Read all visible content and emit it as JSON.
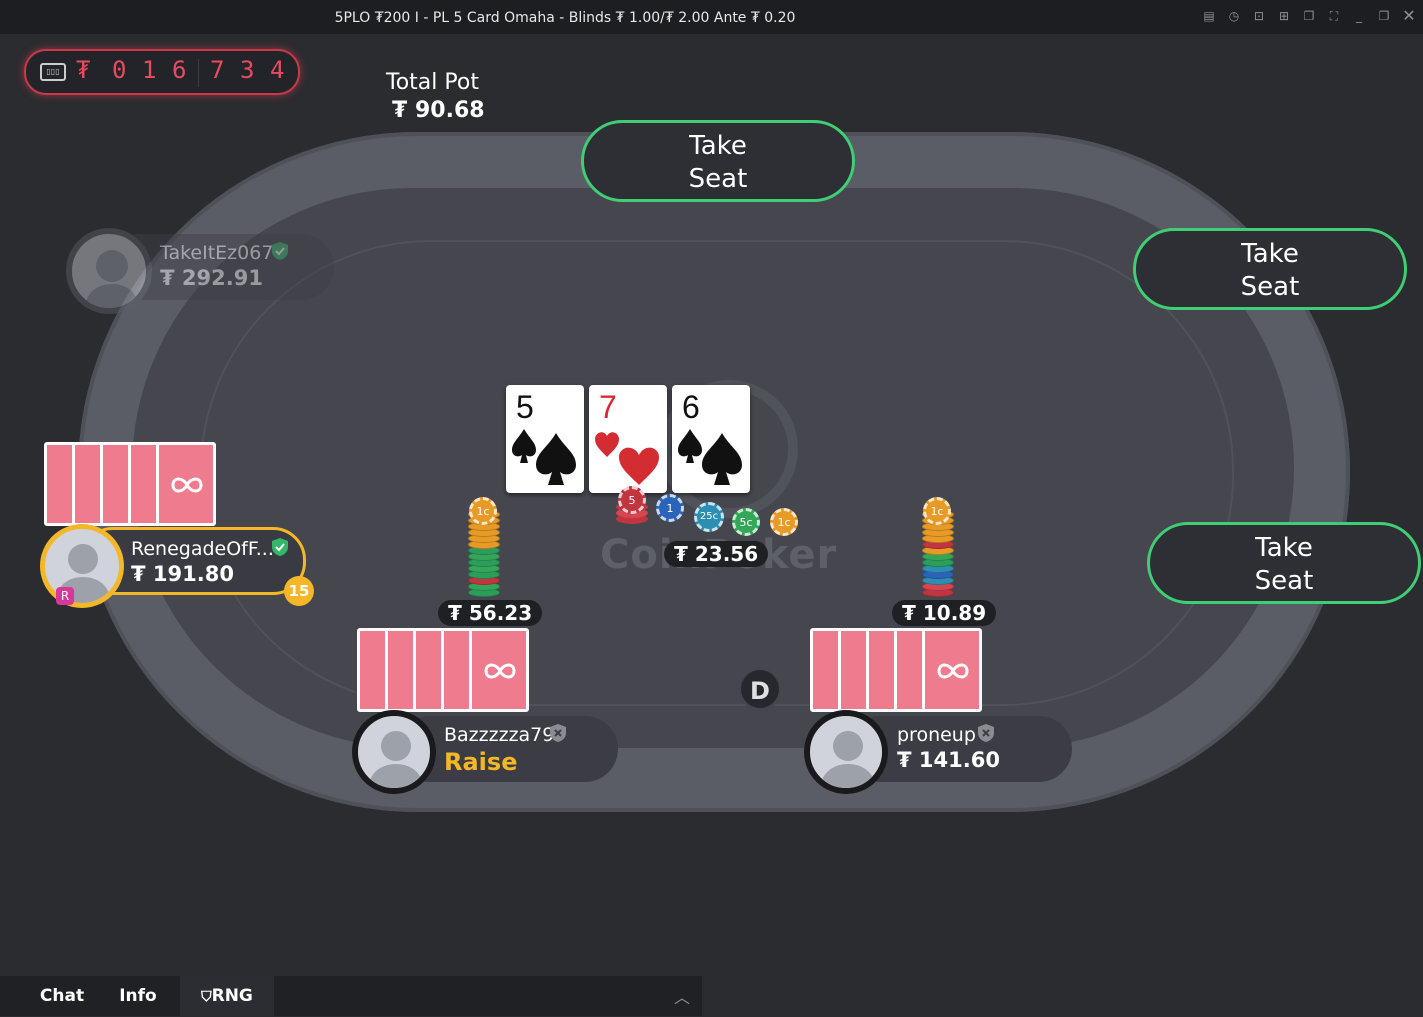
{
  "window": {
    "title": "5PLO ₮200 I - PL 5 Card Omaha - Blinds ₮ 1.00/₮ 2.00 Ante ₮ 0.20"
  },
  "jackpot": {
    "currency": "₮",
    "digits": [
      "0",
      "1",
      "6",
      "7",
      "3",
      "4"
    ]
  },
  "pot": {
    "label": "Total Pot",
    "value": "₮ 90.68",
    "center_bet": "₮ 23.56"
  },
  "table_logo": "CoinPoker",
  "take_seat": {
    "top": "Take\nSeat",
    "right_upper": "Take\nSeat",
    "right_lower": "Take\nSeat"
  },
  "community_cards": [
    {
      "rank": "5",
      "suit": "spades",
      "color": "#111111"
    },
    {
      "rank": "7",
      "suit": "hearts",
      "color": "#d42c33"
    },
    {
      "rank": "6",
      "suit": "spades",
      "color": "#111111"
    }
  ],
  "center_chips": [
    "5",
    "1",
    "25c",
    "5c",
    "1c"
  ],
  "players": {
    "takeitez": {
      "name": "TakeItEz067",
      "stack": "₮ 292.91"
    },
    "renegade": {
      "name": "RenegadeOfF...",
      "stack": "₮ 191.80",
      "timer": "15",
      "badge": "R"
    },
    "bazzz": {
      "name": "Bazzzzza79",
      "action": "Raise",
      "bet": "₮ 56.23",
      "chip_label": "1c"
    },
    "proneup": {
      "name": "proneup",
      "stack": "₮ 141.60",
      "bet": "₮ 10.89",
      "chip_label": "1c"
    }
  },
  "dealer_button": "D",
  "bottom_bar": {
    "chat": "Chat",
    "info": "Info",
    "rng": "RNG"
  },
  "colors": {
    "accent_green": "#3fce75",
    "card_back": "#ef7c8e",
    "action_yellow": "#f4b728",
    "jackpot_red": "#e84c5c"
  }
}
